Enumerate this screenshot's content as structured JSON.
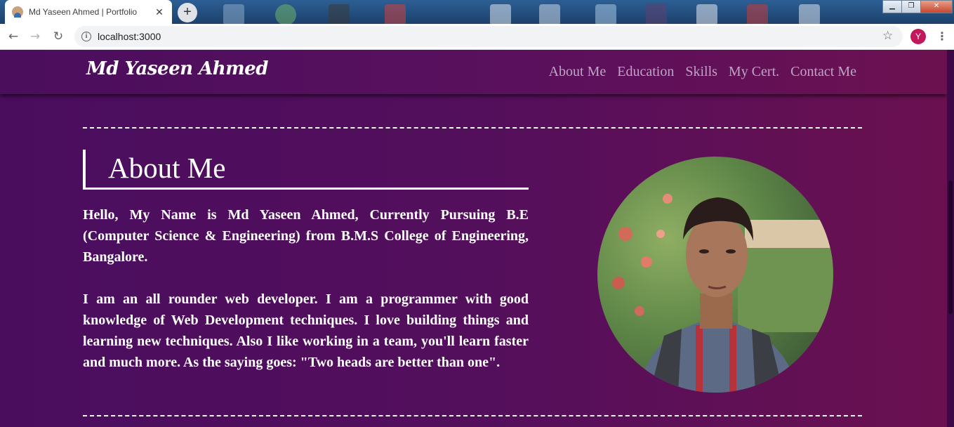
{
  "browser": {
    "tab_title": "Md Yaseen Ahmed | Portfolio",
    "tab_close": "✕",
    "new_tab": "+",
    "url": "localhost:3000",
    "profile_initial": "Y",
    "controls": {
      "minimize": "▁",
      "restore": "❐",
      "close": "✕"
    },
    "icons": {
      "back": "←",
      "forward": "→",
      "reload": "↻",
      "info": "i",
      "star": "☆",
      "menu": "⋮"
    }
  },
  "site": {
    "brand": "Md Yaseen Ahmed",
    "nav": [
      "About Me",
      "Education",
      "Skills",
      "My Cert.",
      "Contact Me"
    ],
    "about": {
      "heading": "About Me",
      "paragraph1": "Hello, My Name is Md Yaseen Ahmed, Currently Pursuing B.E (Computer Science & Engineering) from B.M.S College of Engineering, Bangalore.",
      "paragraph2": "I am an all rounder web developer. I am a programmer with good knowledge of Web Development techniques. I love building things and learning new techniques. Also I like working in a team, you'll learn faster and much more. As the saying goes: \"Two heads are better than one\"."
    }
  },
  "colors": {
    "page_bg_left": "#4a0d5e",
    "page_bg_right": "#6a1050",
    "nav_link": "#bda5c6",
    "avatar": "#c2185b"
  }
}
